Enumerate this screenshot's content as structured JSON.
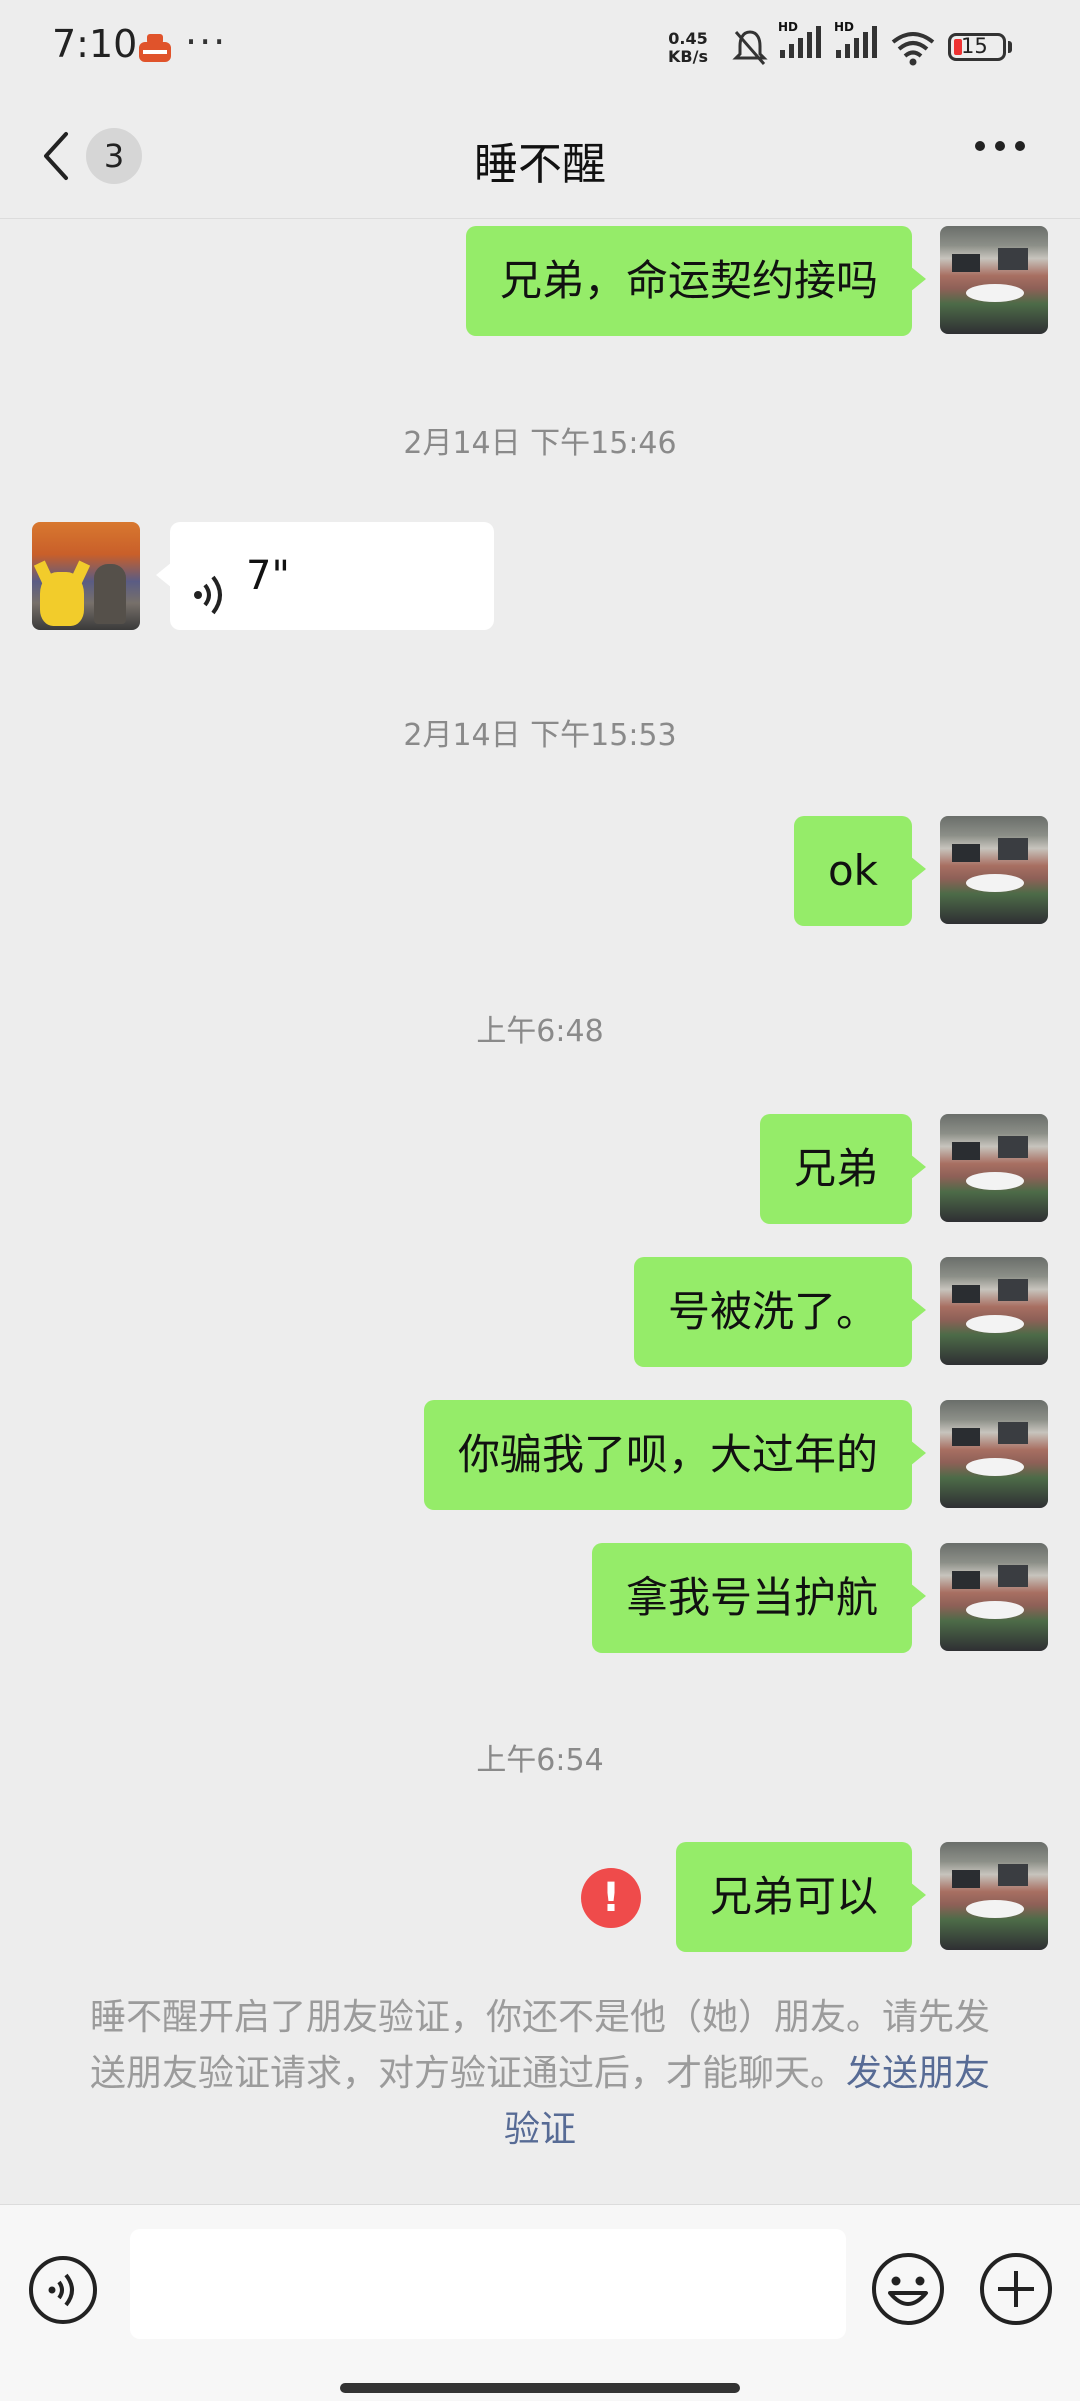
{
  "status_bar": {
    "time": "7:10",
    "more": "···",
    "speed_value": "0.45",
    "speed_unit": "KB/s",
    "signal_label_1": "HD",
    "signal_label_2": "HD",
    "battery": "15",
    "battery_color": "#e33333"
  },
  "nav": {
    "title": "睡不醒",
    "unread_count": "3"
  },
  "messages": [
    {
      "type": "text",
      "sender": "self",
      "text": "兄弟，命运契约接吗"
    },
    {
      "type": "timestamp",
      "text": "2月14日 下午15:46"
    },
    {
      "type": "voice",
      "sender": "other",
      "duration": "7\""
    },
    {
      "type": "timestamp",
      "text": "2月14日 下午15:53"
    },
    {
      "type": "text",
      "sender": "self",
      "text": "ok"
    },
    {
      "type": "timestamp",
      "text": "上午6:48"
    },
    {
      "type": "text",
      "sender": "self",
      "text": "兄弟"
    },
    {
      "type": "text",
      "sender": "self",
      "text": "号被洗了。"
    },
    {
      "type": "text",
      "sender": "self",
      "text": "你骗我了呗，大过年的"
    },
    {
      "type": "text",
      "sender": "self",
      "text": "拿我号当护航"
    },
    {
      "type": "timestamp",
      "text": "上午6:54"
    },
    {
      "type": "text",
      "sender": "self",
      "text": "兄弟可以",
      "send_failed": true,
      "error_mark": "!"
    }
  ],
  "system_notice": {
    "text": "睡不醒开启了朋友验证，你还不是他（她）朋友。请先发送朋友验证请求，对方验证通过后，才能聊天。",
    "link": "发送朋友验证"
  },
  "input_bar": {
    "message_value": ""
  },
  "colors": {
    "bubble_self": "#95ec69",
    "bubble_other": "#ffffff",
    "link": "#576b95",
    "error": "#ef4b4b",
    "background": "#ededed"
  }
}
